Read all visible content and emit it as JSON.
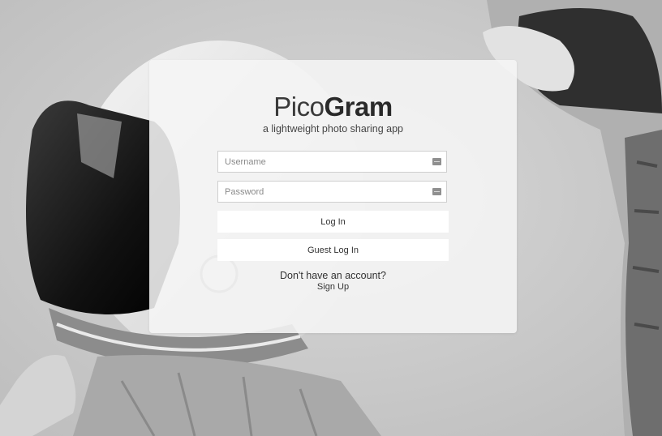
{
  "app": {
    "name_light": "Pico",
    "name_bold": "Gram",
    "tagline": "a lightweight photo sharing app"
  },
  "login_form": {
    "username_placeholder": "Username",
    "username_value": "",
    "password_placeholder": "Password",
    "password_value": "",
    "field_icon": "keyboard-icon",
    "login_label": "Log In",
    "guest_login_label": "Guest Log In"
  },
  "signup": {
    "question": "Don't have an account?",
    "link_label": "Sign Up"
  },
  "background": {
    "description_icon": "astronaut-photo"
  }
}
